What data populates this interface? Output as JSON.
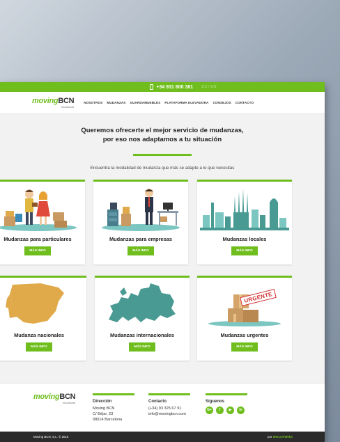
{
  "topbar": {
    "phone": "+34 931 600 381",
    "lang": "ES / EN"
  },
  "brand": {
    "moving": "moving",
    "bcn": "BCN",
    "sub": "mudanzas"
  },
  "nav": {
    "items": [
      "NOSOTROS",
      "MUDANZAS",
      "GUARDAMUEBLES",
      "PLATAFORMA ELEVADORA",
      "CONSEJOS",
      "CONTACTO"
    ]
  },
  "hero": {
    "title_line1": "Queremos ofrecerte el mejor servicio de mudanzas,",
    "title_line2": "por eso nos adaptamos a tu situación",
    "subtitle": "Encuentra la modalidad de mudanza que más se adapte a lo que necesitas"
  },
  "cards": [
    {
      "title": "Mudanzas para particulares",
      "button": "MÁS INFO",
      "icon": "family-boxes-illustration"
    },
    {
      "title": "Mudanzas para empresas",
      "button": "MÁS INFO",
      "icon": "office-illustration"
    },
    {
      "title": "Mudanzas locales",
      "button": "MÁS INFO",
      "icon": "barcelona-skyline-illustration"
    },
    {
      "title": "Mudanza nacionales",
      "button": "MÁS INFO",
      "icon": "spain-map-illustration"
    },
    {
      "title": "Mudanzas internacionales",
      "button": "MÁS INFO",
      "icon": "europe-map-illustration"
    },
    {
      "title": "Mudanzas urgentes",
      "button": "MÁS INFO",
      "icon": "urgent-boxes-illustration",
      "stamp": "URGENTE"
    }
  ],
  "footer": {
    "direccion": {
      "title": "Dirección",
      "lines": [
        "Moving BCN",
        "C/ Béjar, 23",
        "08014 Barcelona"
      ]
    },
    "contacto": {
      "title": "Contacto",
      "lines": [
        "(+34) 93 325 67 91",
        "info@movingbcn.com"
      ]
    },
    "siguenos": {
      "title": "Síguenos",
      "icons": [
        "G+",
        "f",
        "▶",
        "in"
      ]
    },
    "copyright": "Moving BCN, S.L. © 2016",
    "credit_prefix": "por",
    "credit_name": "WeLoveWebs"
  },
  "colors": {
    "accent": "#6fbe1e",
    "dark": "#2b2b2b",
    "map_spain": "#e0a94a",
    "map_europe": "#4a9a94"
  }
}
